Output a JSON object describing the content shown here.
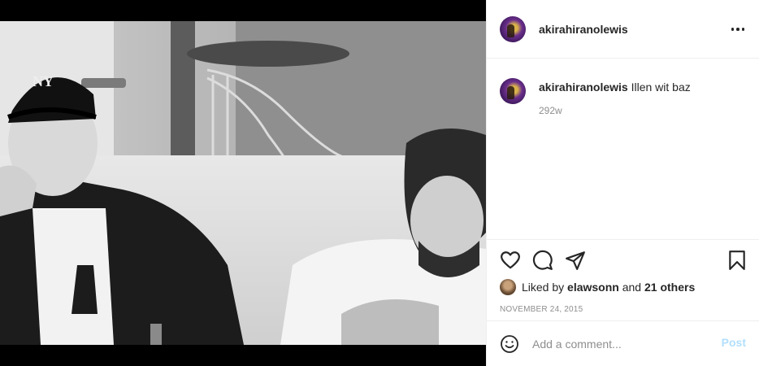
{
  "post": {
    "username": "akirahiranolewis",
    "caption_text": "Illen wit baz",
    "time_ago": "292w",
    "liked_prefix": "Liked by",
    "liked_user": "elawsonn",
    "liked_and": "and",
    "liked_others": "21 others",
    "date": "NOVEMBER 24, 2015"
  },
  "comment_box": {
    "placeholder": "Add a comment...",
    "post_label": "Post"
  },
  "icons": {
    "more": "more-options-icon",
    "like": "heart-icon",
    "comment": "comment-bubble-icon",
    "share": "paper-plane-icon",
    "save": "bookmark-icon",
    "emoji": "emoji-smile-icon"
  },
  "colors": {
    "text": "#262626",
    "secondary": "#8e8e8e",
    "post_button_disabled": "#b2dffc",
    "divider": "#efefef"
  }
}
